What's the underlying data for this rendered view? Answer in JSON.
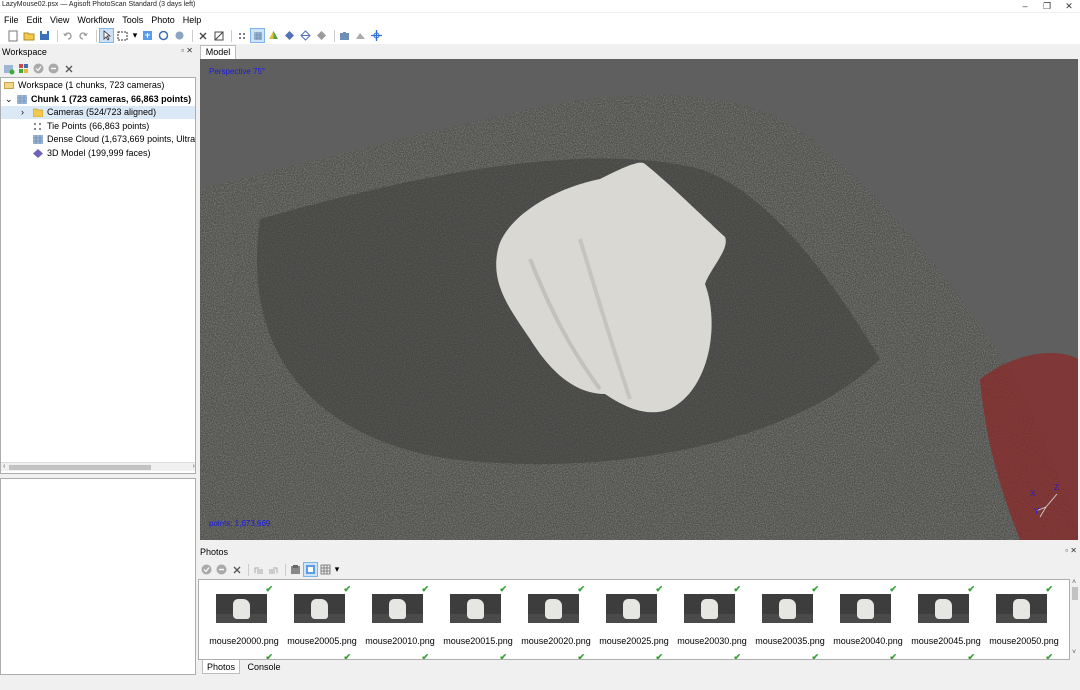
{
  "window": {
    "title": "LazyMouse02.psx — Agisoft PhotoScan Standard (3 days left)",
    "minimize_icon": "minimize-icon",
    "maximize_icon": "restore-icon",
    "close_icon": "close-icon"
  },
  "menu": [
    "File",
    "Edit",
    "View",
    "Workflow",
    "Tools",
    "Photo",
    "Help"
  ],
  "workspace": {
    "title": "Workspace",
    "tree": [
      {
        "label": "Workspace (1 chunks, 723 cameras)",
        "icon": "workspace-icon",
        "indent": 0,
        "bold": false,
        "selected": false
      },
      {
        "label": "Chunk 1 (723 cameras, 66,863 points)",
        "icon": "chunk-icon",
        "indent": 1,
        "bold": true,
        "selected": false
      },
      {
        "label": "Cameras (524/723 aligned)",
        "icon": "folder-icon",
        "indent": 2,
        "bold": false,
        "selected": true
      },
      {
        "label": "Tie Points (66,863 points)",
        "icon": "tie-points-icon",
        "indent": 2,
        "bold": false,
        "selected": false
      },
      {
        "label": "Dense Cloud (1,673,669 points, Ultra",
        "icon": "dense-cloud-icon",
        "indent": 2,
        "bold": false,
        "selected": false
      },
      {
        "label": "3D Model (199,999 faces)",
        "icon": "model-icon",
        "indent": 2,
        "bold": false,
        "selected": false
      }
    ]
  },
  "model": {
    "tab": "Model",
    "view_label": "Perspective 75°",
    "points_label": "points: 1,673,669",
    "axis_x": "X",
    "axis_y": "Y",
    "axis_z": "Z"
  },
  "photos": {
    "title": "Photos",
    "items": [
      "mouse20000.png",
      "mouse20005.png",
      "mouse20010.png",
      "mouse20015.png",
      "mouse20020.png",
      "mouse20025.png",
      "mouse20030.png",
      "mouse20035.png",
      "mouse20040.png",
      "mouse20045.png",
      "mouse20050.png"
    ],
    "check_mark": "✔"
  },
  "bottom_tabs": [
    "Photos",
    "Console"
  ],
  "colors": {
    "accent": "#1a1ae6",
    "check": "#33a033",
    "selection": "#dbe8f6"
  }
}
